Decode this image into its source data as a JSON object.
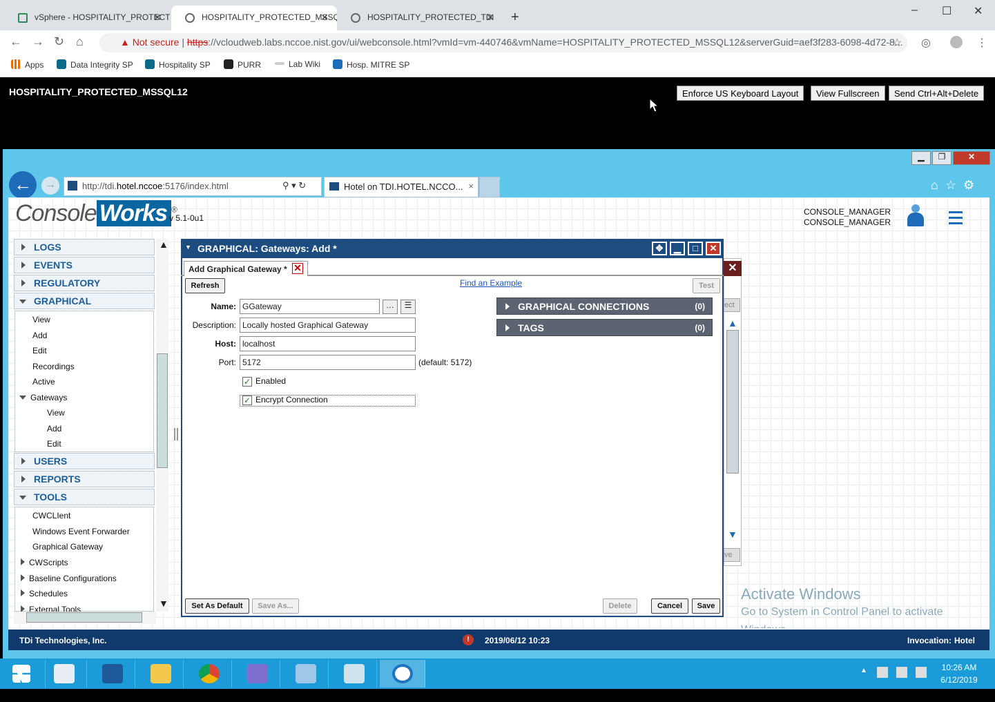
{
  "browser": {
    "tabs": [
      {
        "label": "vSphere - HOSPITALITY_PROTECT",
        "active": false
      },
      {
        "label": "HOSPITALITY_PROTECTED_MSSQ",
        "active": true
      },
      {
        "label": "HOSPITALITY_PROTECTED_TDi",
        "active": false
      }
    ],
    "new_tab": "+",
    "window_controls": {
      "minimize": "–",
      "maximize": "☐",
      "close": "✕"
    },
    "not_secure": "Not secure",
    "url_scheme": "https",
    "url_rest": "://vcloudweb.labs.nccoe.nist.gov/ui/webconsole.html?vmId=vm-440746&vmName=HOSPITALITY_PROTECTED_MSSQL12&serverGuid=aef3f283-6098-4d72-8...",
    "bookmarks": [
      "Apps",
      "Data Integrity SP",
      "Hospitality SP",
      "PURR",
      "Lab Wiki",
      "Hosp. MITRE SP"
    ]
  },
  "vm": {
    "title": "HOSPITALITY_PROTECTED_MSSQL12",
    "buttons": [
      "Enforce US Keyboard Layout",
      "View Fullscreen",
      "Send Ctrl+Alt+Delete"
    ]
  },
  "ie": {
    "url_prefix": "http://tdi.",
    "url_host": "hotel.nccoe",
    "url_suffix": ":5176/index.html",
    "tab_title": "Hotel on TDI.HOTEL.NCCO...",
    "tab_close": "×"
  },
  "consoleworks": {
    "logo_a": "Console",
    "logo_b": "Works",
    "logo_reg": "®",
    "version": "v 5.1-0u1",
    "user_line1": "CONSOLE_MANAGER",
    "user_line2": "CONSOLE_MANAGER"
  },
  "menu": {
    "sections": {
      "logs": "LOGS",
      "events": "EVENTS",
      "regulatory": "REGULATORY",
      "graphical": "GRAPHICAL",
      "users": "USERS",
      "reports": "REPORTS",
      "tools": "TOOLS"
    },
    "graphical_items": [
      "View",
      "Add",
      "Edit",
      "Recordings",
      "Active",
      "Gateways"
    ],
    "gateway_items": [
      "View",
      "Add",
      "Edit"
    ],
    "tools_items": [
      "CWCLIent",
      "Windows Event Forwarder",
      "Graphical Gateway",
      "CWScripts",
      "Baseline Configurations",
      "Schedules",
      "External Tools"
    ]
  },
  "dialog": {
    "title": "GRAPHICAL: Gateways: Add *",
    "tab_label": "Add Graphical Gateway *",
    "refresh": "Refresh",
    "find_example": "Find an Example",
    "test": "Test",
    "fields": {
      "name_label": "Name:",
      "name_value": "GGateway",
      "description_label": "Description:",
      "description_value": "Locally hosted Graphical Gateway",
      "host_label": "Host:",
      "host_value": "localhost",
      "port_label": "Port:",
      "port_value": "5172",
      "port_hint": "(default: 5172)",
      "enabled_label": "Enabled",
      "encrypt_label": "Encrypt Connection"
    },
    "panels": [
      {
        "label": "GRAPHICAL CONNECTIONS",
        "count": "(0)"
      },
      {
        "label": "TAGS",
        "count": "(0)"
      }
    ],
    "footer": {
      "set_default": "Set As Default",
      "save_as": "Save As...",
      "delete": "Delete",
      "cancel": "Cancel",
      "save": "Save"
    },
    "behind_fragments": {
      "ect": "ect",
      "ve": "ve"
    }
  },
  "status": {
    "company": "TDi Technologies, Inc.",
    "datetime": "2019/06/12 10:23",
    "invocation_label": "Invocation:",
    "invocation_value": "Hotel"
  },
  "watermark": {
    "line1": "Activate Windows",
    "line2": "Go to System in Control Panel to activate",
    "line3": "Windows."
  },
  "taskbar": {
    "time": "10:26 AM",
    "date": "6/12/2019"
  }
}
